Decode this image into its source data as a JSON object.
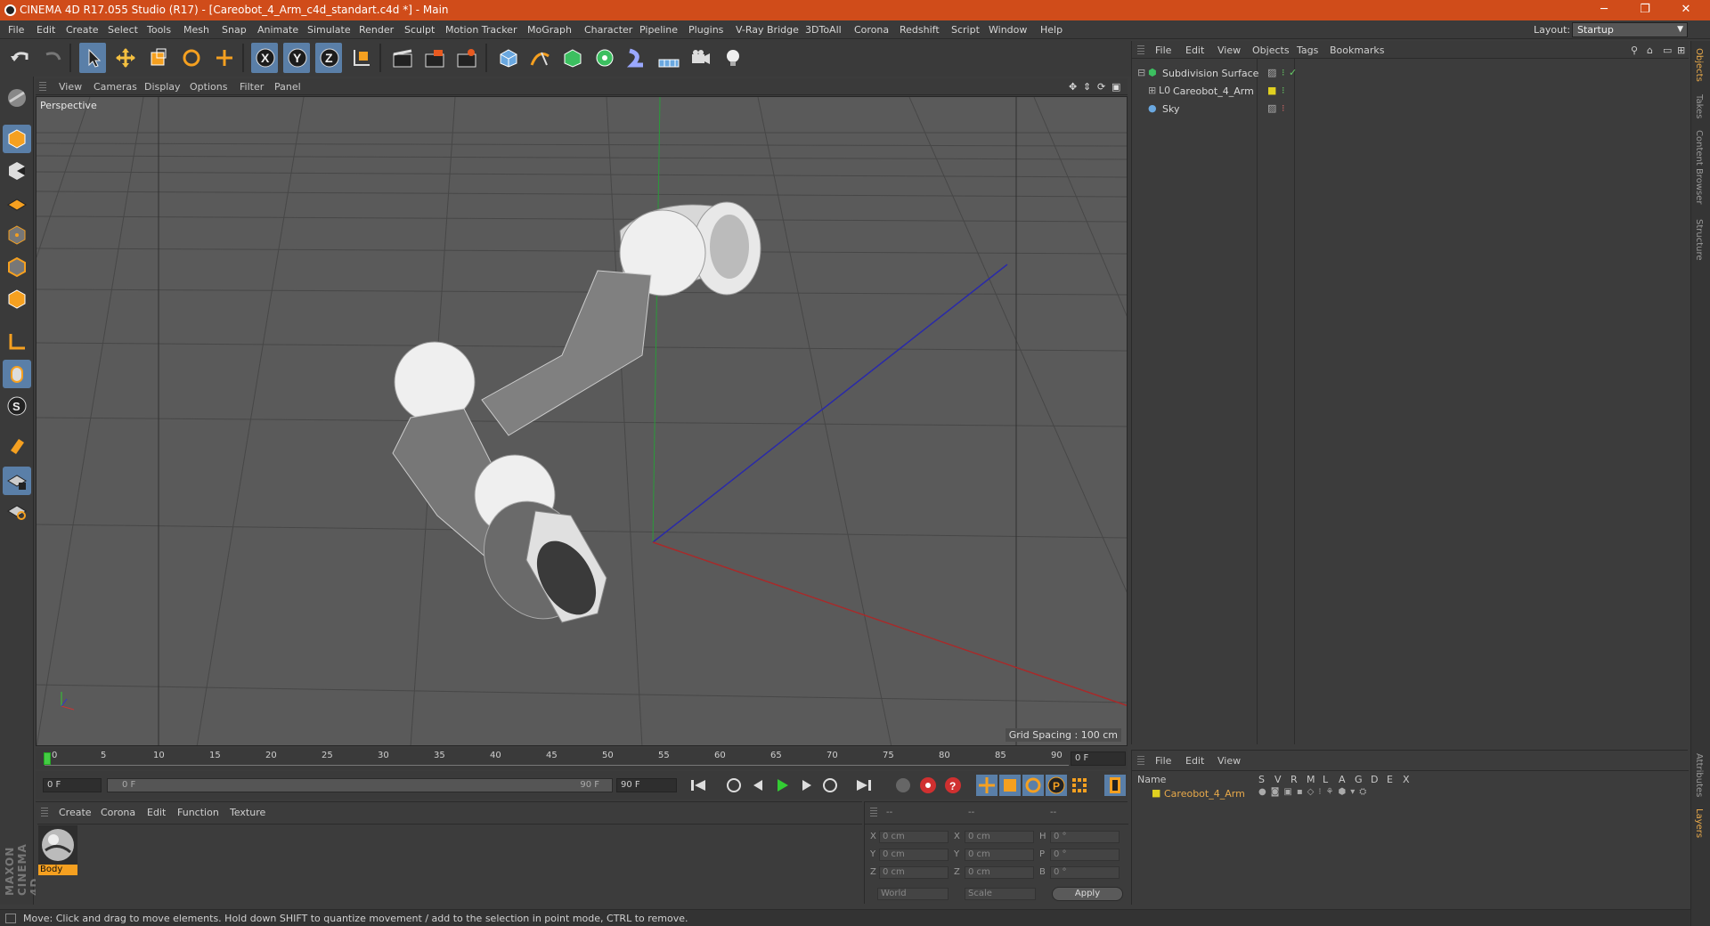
{
  "window": {
    "title": "CINEMA 4D R17.055 Studio (R17) - [Careobot_4_Arm_c4d_standart.c4d *] - Main",
    "minimize": "─",
    "restore": "❐",
    "close": "✕"
  },
  "menu": [
    "File",
    "Edit",
    "Create",
    "Select",
    "Tools",
    "Mesh",
    "Snap",
    "Animate",
    "Simulate",
    "Render",
    "Sculpt",
    "Motion Tracker",
    "MoGraph",
    "Character",
    "Pipeline",
    "Plugins",
    "V-Ray Bridge",
    "3DToAll",
    "Corona",
    "Redshift",
    "Script",
    "Window",
    "Help"
  ],
  "layout": {
    "label": "Layout:",
    "value": "Startup"
  },
  "viewport": {
    "menu": [
      "View",
      "Cameras",
      "Display",
      "Options",
      "Filter",
      "Panel"
    ],
    "label": "Perspective",
    "grid_spacing": "Grid Spacing : 100 cm"
  },
  "objects_panel": {
    "menu": [
      "File",
      "Edit",
      "View",
      "Objects",
      "Tags",
      "Bookmarks"
    ],
    "items": [
      "Subdivision Surface",
      "Careobot_4_Arm",
      "Sky"
    ]
  },
  "right_tabs": [
    "Objects",
    "Takes",
    "Content Browser",
    "Structure",
    "Attributes",
    "Layers"
  ],
  "timeline": {
    "ticks": [
      "0",
      "5",
      "10",
      "15",
      "20",
      "25",
      "30",
      "35",
      "40",
      "45",
      "50",
      "55",
      "60",
      "65",
      "70",
      "75",
      "80",
      "85",
      "90"
    ],
    "current_frame": "0 F"
  },
  "transport": {
    "start": "0 F",
    "range_start": "0 F",
    "range_end": "90 F",
    "end": "90 F"
  },
  "materials": {
    "menu": [
      "Create",
      "Corona",
      "Edit",
      "Function",
      "Texture"
    ],
    "items": [
      {
        "name": "Body"
      }
    ]
  },
  "coords": {
    "header": [
      "--",
      "--",
      "--"
    ],
    "rows": [
      {
        "a": "X",
        "v1": "0 cm",
        "b": "X",
        "v2": "0 cm",
        "c": "H",
        "v3": "0 °"
      },
      {
        "a": "Y",
        "v1": "0 cm",
        "b": "Y",
        "v2": "0 cm",
        "c": "P",
        "v3": "0 °"
      },
      {
        "a": "Z",
        "v1": "0 cm",
        "b": "Z",
        "v2": "0 cm",
        "c": "B",
        "v3": "0 °"
      }
    ],
    "world": "World",
    "scale": "Scale",
    "apply": "Apply"
  },
  "layers": {
    "menu": [
      "File",
      "Edit",
      "View"
    ],
    "columns": [
      "Name",
      "S",
      "V",
      "R",
      "M",
      "L",
      "A",
      "G",
      "D",
      "E",
      "X"
    ],
    "items": [
      "Careobot_4_Arm"
    ]
  },
  "status": "Move: Click and drag to move elements. Hold down SHIFT to quantize movement / add to the selection in point mode, CTRL to remove.",
  "brand": "MAXON CINEMA 4D",
  "colors": {
    "title_bar": "#d04c1a",
    "selection": "#5a7fa8",
    "layer_orange": "#e8a94a"
  }
}
